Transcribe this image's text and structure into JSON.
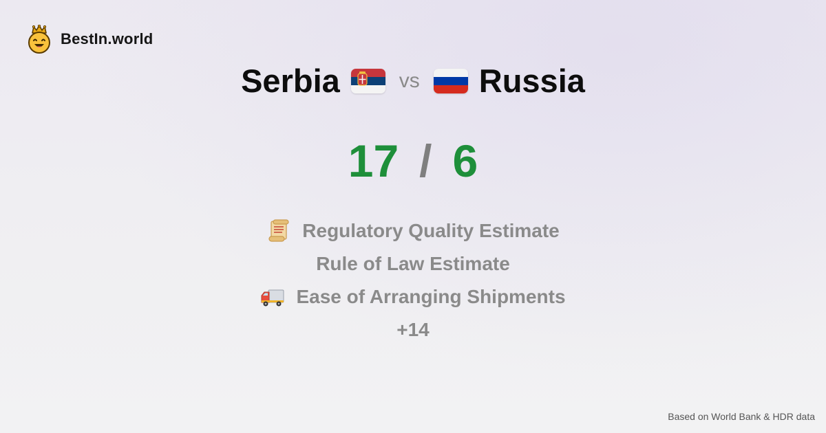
{
  "brand": {
    "name": "BestIn.world",
    "icon": "crown-smiley-icon"
  },
  "comparison": {
    "left_country": "Serbia",
    "vs_label": "vs",
    "right_country": "Russia",
    "left_flag": "serbia-flag-icon",
    "right_flag": "russia-flag-icon"
  },
  "score": {
    "left": "17",
    "separator": "/",
    "right": "6"
  },
  "metrics": [
    {
      "icon": "scroll-icon",
      "label": "Regulatory Quality Estimate"
    },
    {
      "icon": "",
      "label": "Rule of Law Estimate"
    },
    {
      "icon": "delivery-truck-icon",
      "label": "Ease of Arranging Shipments"
    },
    {
      "icon": "",
      "label": "+14"
    }
  ],
  "footer": {
    "source": "Based on World Bank & HDR data"
  },
  "colors": {
    "score": "#1e8f3a",
    "muted": "#8a8a8a",
    "serbia_red": "#c6363c",
    "serbia_blue": "#0c4076",
    "russia_blue": "#0039a6",
    "russia_red": "#d52b1e"
  }
}
